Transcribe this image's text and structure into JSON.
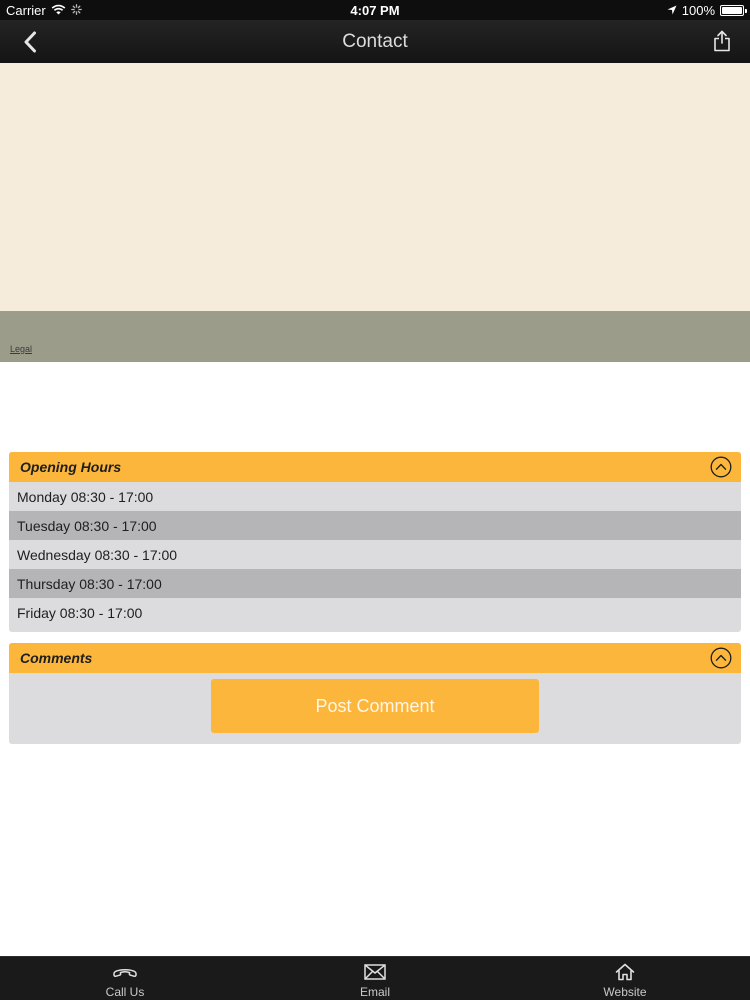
{
  "status_bar": {
    "carrier": "Carrier",
    "time": "4:07 PM",
    "battery": "100%",
    "battery_level": 1.0,
    "icons": [
      "wifi-icon",
      "activity-spinner-icon",
      "location-arrow-icon",
      "battery-icon"
    ]
  },
  "nav": {
    "title": "Contact",
    "icons": [
      "back-chevron-icon",
      "share-icon"
    ]
  },
  "map": {
    "legal_label": "Legal"
  },
  "opening_hours": {
    "title": "Opening Hours",
    "rows": [
      "Monday 08:30 - 17:00",
      "Tuesday 08:30 - 17:00",
      "Wednesday 08:30 - 17:00",
      "Thursday 08:30 - 17:00",
      "Friday 08:30 - 17:00"
    ]
  },
  "comments": {
    "title": "Comments",
    "post_label": "Post Comment"
  },
  "tabs": [
    {
      "label": "Call Us",
      "icon": "phone-icon"
    },
    {
      "label": "Email",
      "icon": "envelope-icon"
    },
    {
      "label": "Website",
      "icon": "home-icon"
    }
  ],
  "colors": {
    "accent": "#fcb63b",
    "panel_bg": "#dcdcde",
    "row_alt": "#b5b5b7",
    "map_bg": "#f5ecdc",
    "map_footer": "#9c9c8a",
    "bar_bg": "#1a1a1a"
  }
}
